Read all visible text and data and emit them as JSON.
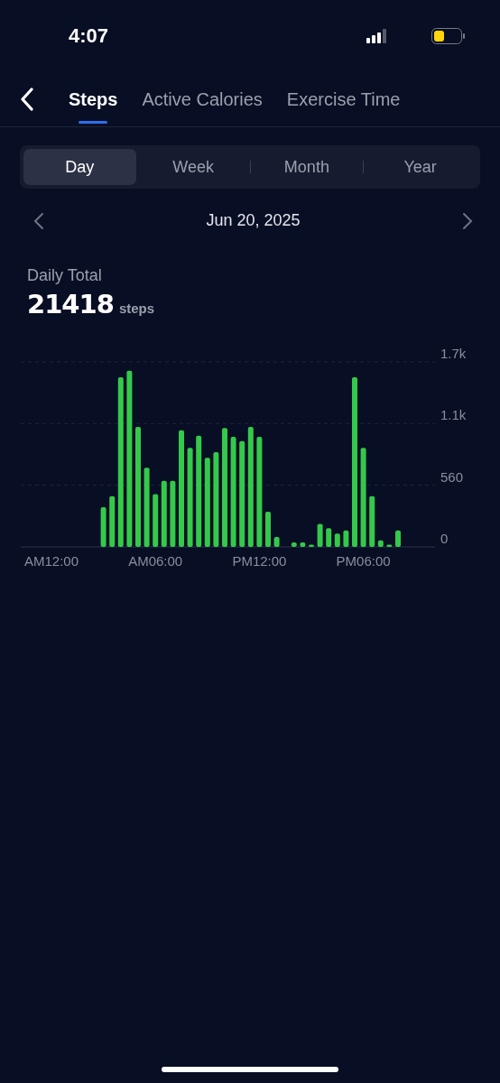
{
  "status_bar": {
    "time": "4:07"
  },
  "tabs": [
    {
      "label": "Steps",
      "selected": true
    },
    {
      "label": "Active Calories",
      "selected": false
    },
    {
      "label": "Exercise Time",
      "selected": false
    }
  ],
  "periods": [
    {
      "label": "Day",
      "selected": true
    },
    {
      "label": "Week",
      "selected": false
    },
    {
      "label": "Month",
      "selected": false
    },
    {
      "label": "Year",
      "selected": false
    }
  ],
  "date": "Jun 20, 2025",
  "summary": {
    "label": "Daily Total",
    "value": "21418",
    "unit": "steps"
  },
  "chart_data": {
    "type": "bar",
    "color": "#34c94a",
    "ylim": [
      0,
      1680
    ],
    "yticks": [
      {
        "value": 0,
        "label": "0"
      },
      {
        "value": 560,
        "label": "560"
      },
      {
        "value": 1120,
        "label": "1.1k"
      },
      {
        "value": 1680,
        "label": "1.7k"
      }
    ],
    "categories": [
      "AM12:00",
      null,
      null,
      null,
      null,
      null,
      null,
      null,
      null,
      null,
      null,
      null,
      "AM06:00",
      null,
      null,
      null,
      null,
      null,
      null,
      null,
      null,
      null,
      null,
      null,
      "PM12:00",
      null,
      null,
      null,
      null,
      null,
      null,
      null,
      null,
      null,
      null,
      null,
      "PM06:00",
      null,
      null,
      null,
      null,
      null,
      null,
      null,
      null
    ],
    "values": [
      0,
      0,
      0,
      0,
      0,
      0,
      360,
      460,
      1540,
      1600,
      1090,
      720,
      480,
      600,
      600,
      1060,
      900,
      1010,
      810,
      860,
      1080,
      1000,
      960,
      1090,
      1000,
      320,
      90,
      0,
      40,
      40,
      20,
      210,
      170,
      120,
      150,
      1540,
      900,
      460,
      60,
      20,
      150,
      0,
      0,
      0,
      0
    ]
  }
}
